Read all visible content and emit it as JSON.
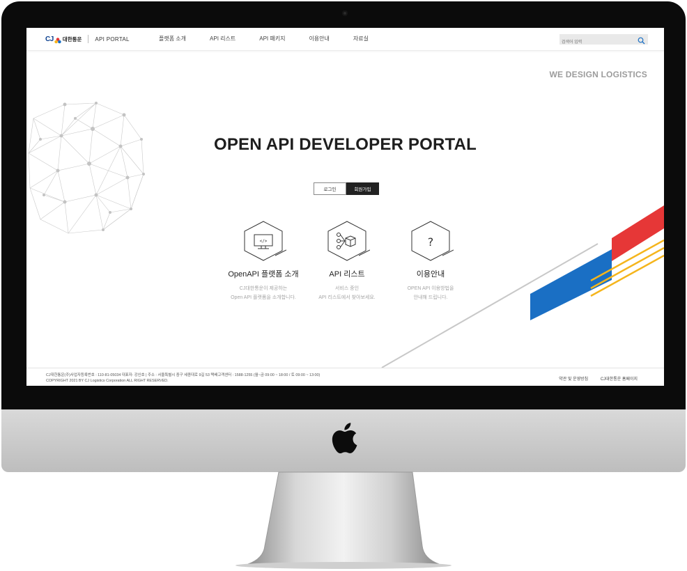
{
  "nav": {
    "logo_cj": "CJ",
    "logo_name": "대한통운",
    "logo_portal": "API PORTAL",
    "menu": [
      "플랫폼 소개",
      "API 리스트",
      "API 패키지",
      "이용안내",
      "자료실"
    ],
    "search_placeholder": "검색어 입력"
  },
  "hero": {
    "tagline": "WE DESIGN LOGISTICS",
    "title": "OPEN API DEVELOPER PORTAL",
    "login_label": "로그인",
    "join_label": "회원가입"
  },
  "cards": [
    {
      "title": "OpenAPI 플랫폼 소개",
      "desc1": "CJ대한통운이 제공하는",
      "desc2": "Open API 플랫폼을 소개합니다.",
      "icon": "code-monitor-icon"
    },
    {
      "title": "API 리스트",
      "desc1": "서비스 중인",
      "desc2": "API 리스트에서 찾아보세요.",
      "icon": "network-box-icon"
    },
    {
      "title": "이용안내",
      "desc1": "OPEN API 이용방법을",
      "desc2": "안내해 드립니다.",
      "icon": "question-icon"
    }
  ],
  "footer": {
    "line1": "CJ대한통운(주)사업자등록번호 : 110-81-05034 대표자: 강신호 | 주소 : 서울특별시 중구 세종대로 9길 53 택배고객센터 : 1588-1255 (월~금 09:00 ~ 18:00 / 토 09:00 ~ 13:00)",
    "line2": "COPYRIGHT 2021 BY CJ Logistics Corporation ALL RIGHT RESERVED.",
    "link1": "약관 및 운영방침",
    "link2": "CJ대한통운 홈페이지"
  },
  "colors": {
    "brand_blue": "#1a6fc4",
    "brand_red": "#e63737",
    "brand_yellow": "#f5b51c",
    "cj_navy": "#0a3f8f"
  }
}
